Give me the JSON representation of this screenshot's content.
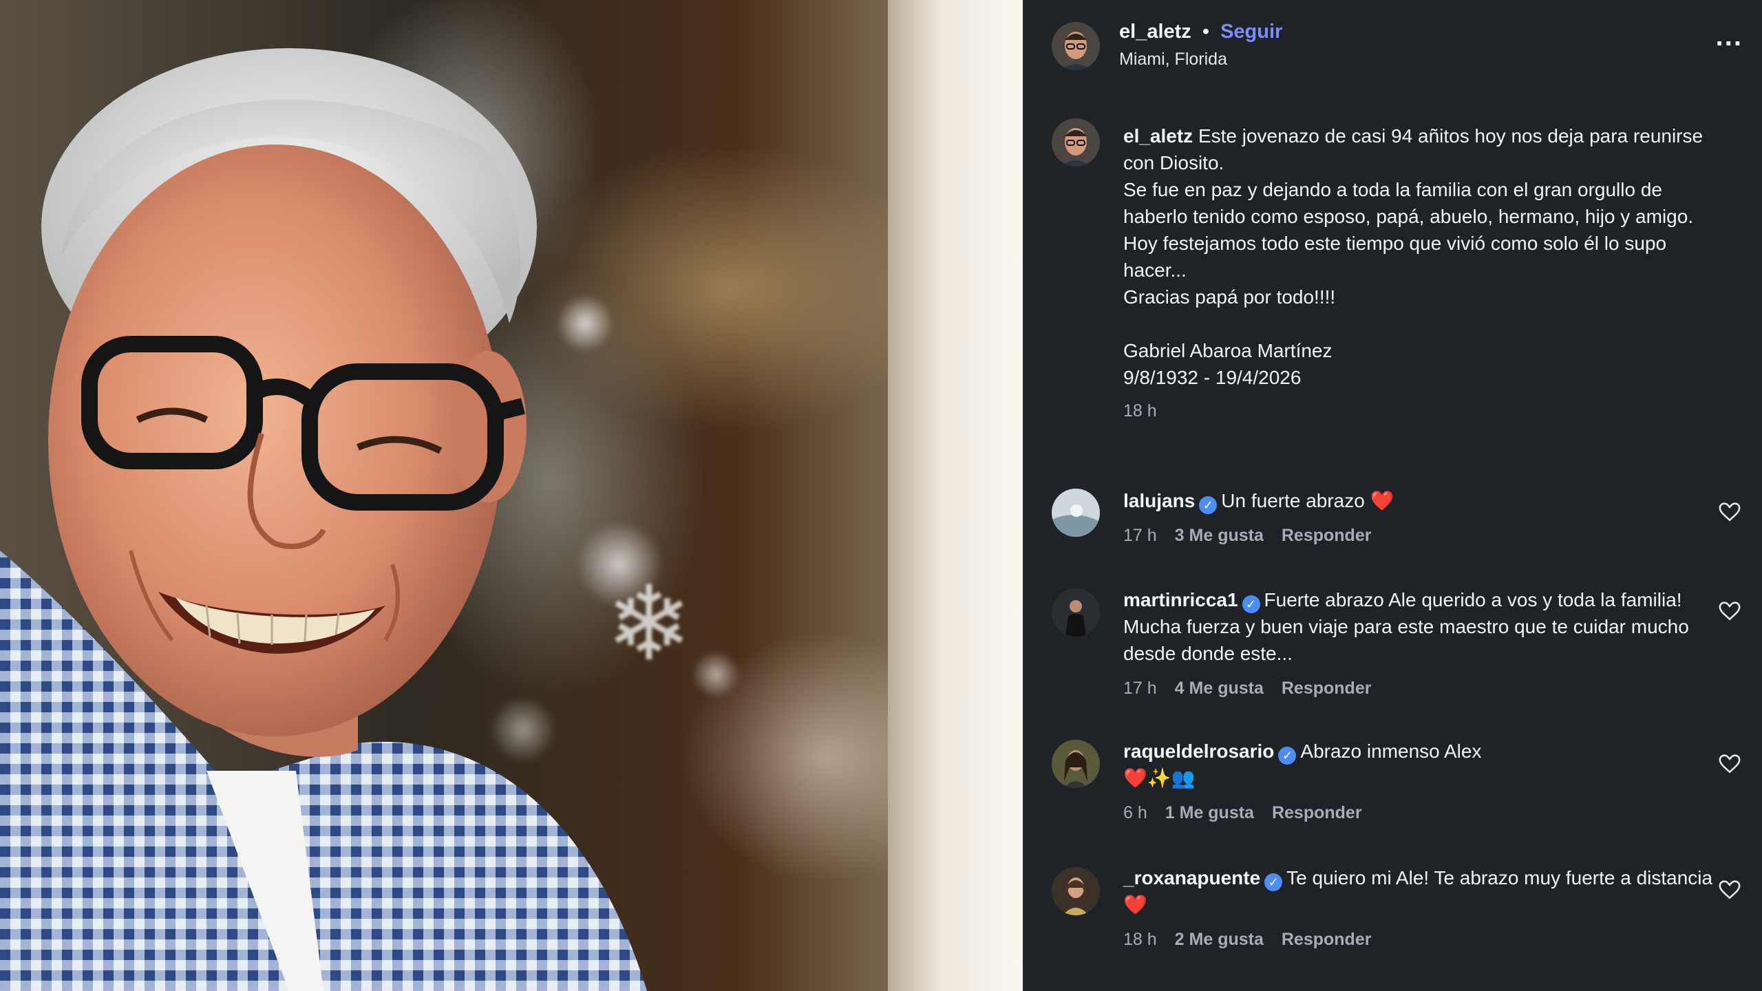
{
  "post": {
    "username": "el_aletz",
    "dot": "•",
    "follow_label": "Seguir",
    "location": "Miami, Florida",
    "more_label": "..."
  },
  "caption": {
    "username": "el_aletz",
    "line1": "Este jovenazo de casi 94 añitos hoy nos deja para reunirse con Diosito.",
    "line2": "Se fue en paz y dejando a toda la familia con el gran orgullo de haberlo tenido como esposo, papá, abuelo, hermano, hijo y amigo.",
    "line3": "Hoy festejamos todo este tiempo que vivió como solo él lo supo hacer...",
    "line4": "Gracias papá por todo!!!!",
    "name_line": "Gabriel Abaroa Martínez",
    "dates_line": "9/8/1932 - 19/4/2026",
    "time": "18 h"
  },
  "comments": [
    {
      "username": "lalujans",
      "text": "Un fuerte abrazo ❤️",
      "time": "17 h",
      "likes": "3 Me gusta",
      "reply": "Responder"
    },
    {
      "username": "martinricca1",
      "text": "Fuerte abrazo Ale querido a vos y toda la familia! Mucha fuerza y buen viaje para este maestro que te cuidar mucho desde donde este...",
      "time": "17 h",
      "likes": "4 Me gusta",
      "reply": "Responder"
    },
    {
      "username": "raqueldelrosario",
      "text": "Abrazo inmenso Alex",
      "text2": "❤️✨👥",
      "time": "6 h",
      "likes": "1 Me gusta",
      "reply": "Responder"
    },
    {
      "username": "_roxanapuente",
      "text": "Te quiero mi Ale! Te abrazo muy fuerte a distancia ❤️",
      "time": "18 h",
      "likes": "2 Me gusta",
      "reply": "Responder"
    }
  ],
  "icons": {
    "verified": "✓"
  },
  "colors": {
    "panel_bg": "#1f2226",
    "follow_blue": "#7b8cff",
    "verified_blue": "#4d8df5",
    "heart_red": "#e0245e"
  }
}
